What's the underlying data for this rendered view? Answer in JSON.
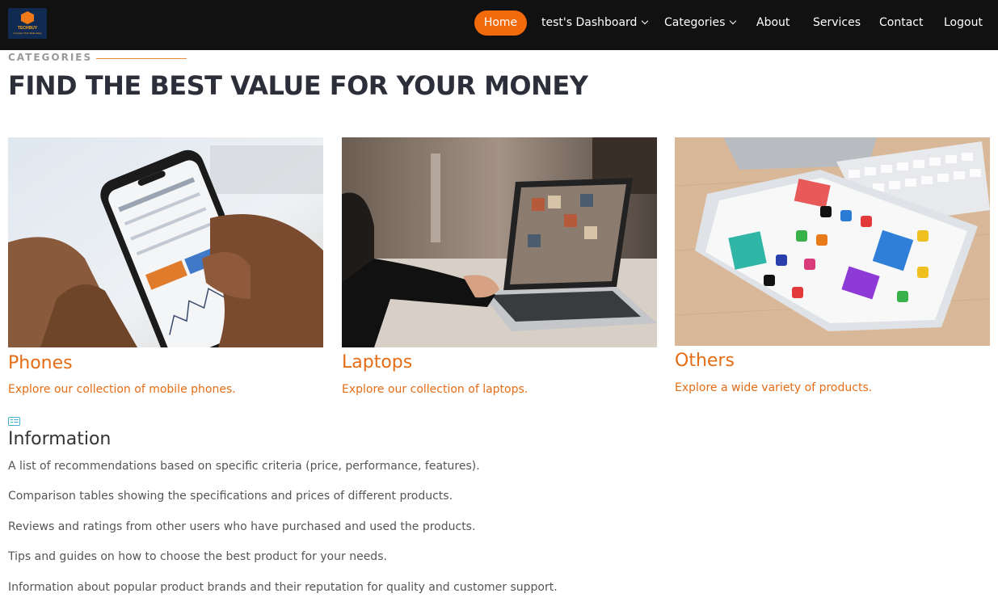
{
  "nav": {
    "logo_text": "TECHBUY",
    "logo_subtext": "Compare Tech Make Easy",
    "items": [
      {
        "label": "Home",
        "active": true
      },
      {
        "label": "test's Dashboard",
        "dropdown": true
      },
      {
        "label": "Categories",
        "dropdown": true
      },
      {
        "label": "About"
      },
      {
        "label": "Services"
      },
      {
        "label": "Contact"
      },
      {
        "label": "Logout"
      }
    ]
  },
  "section": {
    "label": "CATEGORIES",
    "title": "FIND THE BEST VALUE FOR YOUR MONEY"
  },
  "cards": [
    {
      "title": "Phones",
      "description": "Explore our collection of mobile phones.",
      "image": "hand-holding-smartphone-trading-app"
    },
    {
      "title": "Laptops",
      "description": "Explore our collection of laptops.",
      "image": "person-using-laptop-photo-gallery"
    },
    {
      "title": "Others",
      "description": "Explore a wide variety of products.",
      "image": "tablet-with-app-icons-and-keyboard"
    }
  ],
  "info": {
    "icon": "list-card-icon",
    "title": "Information",
    "lines": [
      "A list of recommendations based on specific criteria (price, performance, features).",
      "Comparison tables showing the specifications and prices of different products.",
      "Reviews and ratings from other users who have purchased and used the products.",
      "Tips and guides on how to choose the best product for your needs.",
      "Information about popular product brands and their reputation for quality and customer support."
    ]
  },
  "colors": {
    "nav_bg": "#111111",
    "accent": "#f26a0c",
    "card_text": "#e46d16",
    "title_dark": "#2c2e3a",
    "info_icon": "#46b3c9"
  }
}
